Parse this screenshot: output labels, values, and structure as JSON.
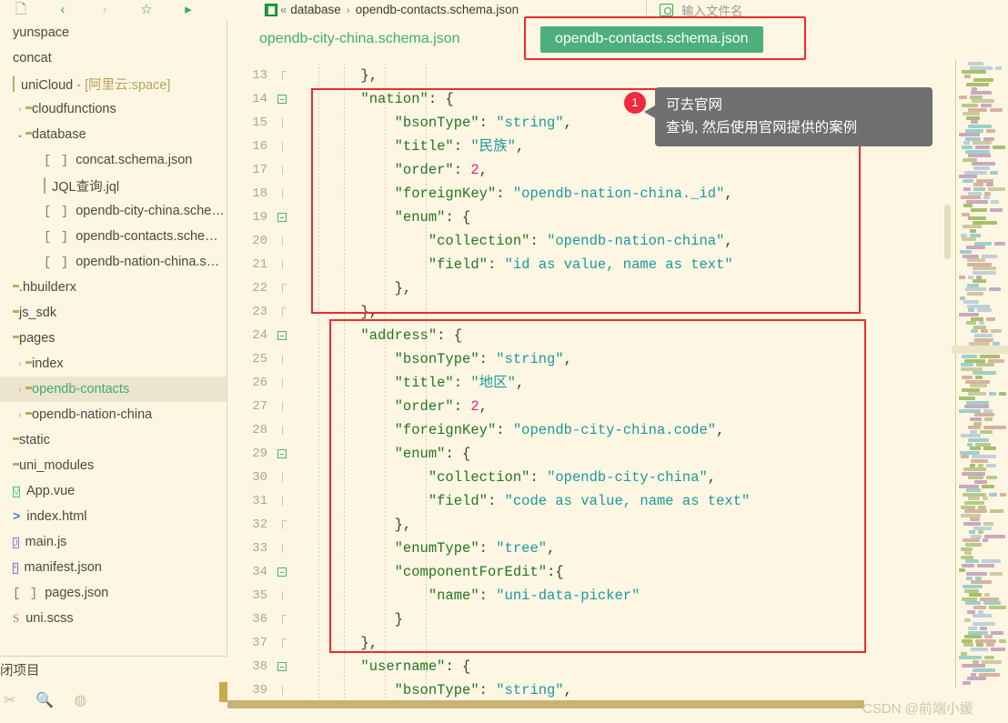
{
  "toolbar": {
    "icons": [
      {
        "name": "new-file-icon",
        "glyph": "🗋"
      },
      {
        "name": "back-icon",
        "glyph": "‹"
      },
      {
        "name": "forward-icon",
        "glyph": "›"
      },
      {
        "name": "favorite-star-icon",
        "glyph": "☆"
      },
      {
        "name": "run-icon",
        "glyph": "▷"
      }
    ],
    "breadcrumb": {
      "chevrons": "«",
      "folder": "database",
      "arrow": "›",
      "file": "opendb-contacts.schema.json"
    },
    "search": {
      "placeholder": "输入文件名",
      "value": "",
      "icon": "search-file-icon"
    }
  },
  "sidebar": {
    "items": [
      {
        "label": "yunspace",
        "icon": "none",
        "indent": 0,
        "chevron": "",
        "style": "plain"
      },
      {
        "label": "concat",
        "icon": "none",
        "indent": 0,
        "chevron": "",
        "style": "plain"
      },
      {
        "label": "uniCloud - [阿里云:space]",
        "icon": "cloud",
        "indent": 0,
        "chevron": "",
        "style": "unicloud"
      },
      {
        "label": "cloudfunctions",
        "icon": "folder-pale",
        "indent": 14,
        "chevron": "›",
        "style": "plain"
      },
      {
        "label": "database",
        "icon": "folder-open",
        "indent": 14,
        "chevron": "⌄",
        "style": "plain"
      },
      {
        "label": "concat.schema.json",
        "icon": "bracket",
        "indent": 34,
        "chevron": "",
        "style": "plain"
      },
      {
        "label": "JQL查询.jql",
        "icon": "jql",
        "indent": 34,
        "chevron": "",
        "style": "plain"
      },
      {
        "label": "opendb-city-china.sche…",
        "icon": "bracket",
        "indent": 34,
        "chevron": "",
        "style": "plain"
      },
      {
        "label": "opendb-contacts.sche…",
        "icon": "bracket",
        "indent": 34,
        "chevron": "",
        "style": "plain"
      },
      {
        "label": "opendb-nation-china.s…",
        "icon": "bracket",
        "indent": 34,
        "chevron": "",
        "style": "plain"
      },
      {
        "label": ".hbuilderx",
        "icon": "folder-closed",
        "indent": 0,
        "chevron": "",
        "style": "plain"
      },
      {
        "label": "js_sdk",
        "icon": "folder-closed",
        "indent": 0,
        "chevron": "",
        "style": "plain"
      },
      {
        "label": "pages",
        "icon": "folder-open",
        "indent": 0,
        "chevron": "",
        "style": "plain"
      },
      {
        "label": "index",
        "icon": "folder-closed",
        "indent": 14,
        "chevron": "›",
        "style": "plain"
      },
      {
        "label": "opendb-contacts",
        "icon": "folder-closed",
        "indent": 14,
        "chevron": "›",
        "style": "selected"
      },
      {
        "label": "opendb-nation-china",
        "icon": "folder-closed",
        "indent": 14,
        "chevron": "›",
        "style": "plain"
      },
      {
        "label": "static",
        "icon": "folder-closed",
        "indent": 0,
        "chevron": "",
        "style": "plain"
      },
      {
        "label": "uni_modules",
        "icon": "folder-closed",
        "indent": 0,
        "chevron": "",
        "style": "plain"
      },
      {
        "label": "App.vue",
        "icon": "vue",
        "indent": 0,
        "chevron": "",
        "style": "plain"
      },
      {
        "label": "index.html",
        "icon": "html",
        "indent": 0,
        "chevron": "",
        "style": "plain"
      },
      {
        "label": "main.js",
        "icon": "js",
        "indent": 0,
        "chevron": "",
        "style": "plain"
      },
      {
        "label": "manifest.json",
        "icon": "json",
        "indent": 0,
        "chevron": "",
        "style": "plain"
      },
      {
        "label": "pages.json",
        "icon": "bracket",
        "indent": 0,
        "chevron": "",
        "style": "plain"
      },
      {
        "label": "uni.scss",
        "icon": "scss",
        "indent": 0,
        "chevron": "",
        "style": "plain"
      }
    ],
    "close_project_label": "闭项目",
    "bottom_icons": [
      {
        "name": "cut-icon",
        "glyph": "✂"
      },
      {
        "name": "find-in-files-icon",
        "glyph": "🔍"
      },
      {
        "name": "cloud-globe-icon",
        "glyph": "◍"
      }
    ]
  },
  "tabs": [
    {
      "label": "opendb-city-china.schema.json",
      "active": false
    },
    {
      "label": "opendb-contacts.schema.json",
      "active": true
    }
  ],
  "callout": {
    "badge": "1",
    "line1": "可去官网",
    "line2": "查询, 然后使用官网提供的案例"
  },
  "editor": {
    "first_line_number": 13,
    "lines": [
      {
        "num": 13,
        "fold": "tick-cap",
        "tokens": [
          {
            "t": "        },",
            "c": "p"
          }
        ]
      },
      {
        "num": 14,
        "fold": "box",
        "tokens": [
          {
            "t": "        ",
            "c": "p"
          },
          {
            "t": "\"nation\"",
            "c": "k"
          },
          {
            "t": ": {",
            "c": "p"
          }
        ]
      },
      {
        "num": 15,
        "fold": "tick",
        "tokens": [
          {
            "t": "            ",
            "c": "p"
          },
          {
            "t": "\"bsonType\"",
            "c": "k"
          },
          {
            "t": ": ",
            "c": "p"
          },
          {
            "t": "\"string\"",
            "c": "s"
          },
          {
            "t": ",",
            "c": "p"
          }
        ]
      },
      {
        "num": 16,
        "fold": "tick",
        "tokens": [
          {
            "t": "            ",
            "c": "p"
          },
          {
            "t": "\"title\"",
            "c": "k"
          },
          {
            "t": ": ",
            "c": "p"
          },
          {
            "t": "\"民族\"",
            "c": "s"
          },
          {
            "t": ",",
            "c": "p"
          }
        ]
      },
      {
        "num": 17,
        "fold": "tick",
        "tokens": [
          {
            "t": "            ",
            "c": "p"
          },
          {
            "t": "\"order\"",
            "c": "k"
          },
          {
            "t": ": ",
            "c": "p"
          },
          {
            "t": "2",
            "c": "n"
          },
          {
            "t": ",",
            "c": "p"
          }
        ]
      },
      {
        "num": 18,
        "fold": "tick",
        "tokens": [
          {
            "t": "            ",
            "c": "p"
          },
          {
            "t": "\"foreignKey\"",
            "c": "k"
          },
          {
            "t": ": ",
            "c": "p"
          },
          {
            "t": "\"opendb-nation-china._id\"",
            "c": "s"
          },
          {
            "t": ",",
            "c": "p"
          }
        ]
      },
      {
        "num": 19,
        "fold": "box",
        "tokens": [
          {
            "t": "            ",
            "c": "p"
          },
          {
            "t": "\"enum\"",
            "c": "k"
          },
          {
            "t": ": {",
            "c": "p"
          }
        ]
      },
      {
        "num": 20,
        "fold": "tick",
        "tokens": [
          {
            "t": "                ",
            "c": "p"
          },
          {
            "t": "\"collection\"",
            "c": "k"
          },
          {
            "t": ": ",
            "c": "p"
          },
          {
            "t": "\"opendb-nation-china\"",
            "c": "s"
          },
          {
            "t": ",",
            "c": "p"
          }
        ]
      },
      {
        "num": 21,
        "fold": "tick",
        "tokens": [
          {
            "t": "                ",
            "c": "p"
          },
          {
            "t": "\"field\"",
            "c": "k"
          },
          {
            "t": ": ",
            "c": "p"
          },
          {
            "t": "\"id as value, name as text\"",
            "c": "s"
          }
        ]
      },
      {
        "num": 22,
        "fold": "tick-cap",
        "tokens": [
          {
            "t": "            },",
            "c": "p"
          }
        ]
      },
      {
        "num": 23,
        "fold": "tick-cap",
        "tokens": [
          {
            "t": "        },",
            "c": "p"
          }
        ]
      },
      {
        "num": 24,
        "fold": "box",
        "tokens": [
          {
            "t": "        ",
            "c": "p"
          },
          {
            "t": "\"address\"",
            "c": "k"
          },
          {
            "t": ": {",
            "c": "p"
          }
        ]
      },
      {
        "num": 25,
        "fold": "tick",
        "tokens": [
          {
            "t": "            ",
            "c": "p"
          },
          {
            "t": "\"bsonType\"",
            "c": "k"
          },
          {
            "t": ": ",
            "c": "p"
          },
          {
            "t": "\"string\"",
            "c": "s"
          },
          {
            "t": ",",
            "c": "p"
          }
        ]
      },
      {
        "num": 26,
        "fold": "tick",
        "tokens": [
          {
            "t": "            ",
            "c": "p"
          },
          {
            "t": "\"title\"",
            "c": "k"
          },
          {
            "t": ": ",
            "c": "p"
          },
          {
            "t": "\"地区\"",
            "c": "s"
          },
          {
            "t": ",",
            "c": "p"
          }
        ]
      },
      {
        "num": 27,
        "fold": "tick",
        "tokens": [
          {
            "t": "            ",
            "c": "p"
          },
          {
            "t": "\"order\"",
            "c": "k"
          },
          {
            "t": ": ",
            "c": "p"
          },
          {
            "t": "2",
            "c": "n"
          },
          {
            "t": ",",
            "c": "p"
          }
        ]
      },
      {
        "num": 28,
        "fold": "tick",
        "tokens": [
          {
            "t": "            ",
            "c": "p"
          },
          {
            "t": "\"foreignKey\"",
            "c": "k"
          },
          {
            "t": ": ",
            "c": "p"
          },
          {
            "t": "\"opendb-city-china.code\"",
            "c": "s"
          },
          {
            "t": ",",
            "c": "p"
          }
        ]
      },
      {
        "num": 29,
        "fold": "box",
        "tokens": [
          {
            "t": "            ",
            "c": "p"
          },
          {
            "t": "\"enum\"",
            "c": "k"
          },
          {
            "t": ": {",
            "c": "p"
          }
        ]
      },
      {
        "num": 30,
        "fold": "tick",
        "tokens": [
          {
            "t": "                ",
            "c": "p"
          },
          {
            "t": "\"collection\"",
            "c": "k"
          },
          {
            "t": ": ",
            "c": "p"
          },
          {
            "t": "\"opendb-city-china\"",
            "c": "s"
          },
          {
            "t": ",",
            "c": "p"
          }
        ]
      },
      {
        "num": 31,
        "fold": "tick",
        "tokens": [
          {
            "t": "                ",
            "c": "p"
          },
          {
            "t": "\"field\"",
            "c": "k"
          },
          {
            "t": ": ",
            "c": "p"
          },
          {
            "t": "\"code as value, name as text\"",
            "c": "s"
          }
        ]
      },
      {
        "num": 32,
        "fold": "tick-cap",
        "tokens": [
          {
            "t": "            },",
            "c": "p"
          }
        ]
      },
      {
        "num": 33,
        "fold": "tick",
        "tokens": [
          {
            "t": "            ",
            "c": "p"
          },
          {
            "t": "\"enumType\"",
            "c": "k"
          },
          {
            "t": ": ",
            "c": "p"
          },
          {
            "t": "\"tree\"",
            "c": "s"
          },
          {
            "t": ",",
            "c": "p"
          }
        ]
      },
      {
        "num": 34,
        "fold": "box",
        "tokens": [
          {
            "t": "            ",
            "c": "p"
          },
          {
            "t": "\"componentForEdit\"",
            "c": "k"
          },
          {
            "t": ":{",
            "c": "p"
          }
        ]
      },
      {
        "num": 35,
        "fold": "tick",
        "tokens": [
          {
            "t": "                ",
            "c": "p"
          },
          {
            "t": "\"name\"",
            "c": "k"
          },
          {
            "t": ": ",
            "c": "p"
          },
          {
            "t": "\"uni-data-picker\"",
            "c": "s"
          }
        ]
      },
      {
        "num": 36,
        "fold": "tick-cap",
        "tokens": [
          {
            "t": "            }",
            "c": "p"
          }
        ]
      },
      {
        "num": 37,
        "fold": "tick-cap",
        "tokens": [
          {
            "t": "        },",
            "c": "p"
          }
        ]
      },
      {
        "num": 38,
        "fold": "box",
        "tokens": [
          {
            "t": "        ",
            "c": "p"
          },
          {
            "t": "\"username\"",
            "c": "k"
          },
          {
            "t": ": {",
            "c": "p"
          }
        ]
      },
      {
        "num": 39,
        "fold": "tick",
        "tokens": [
          {
            "t": "            ",
            "c": "p"
          },
          {
            "t": "\"bsonType\"",
            "c": "k"
          },
          {
            "t": ": ",
            "c": "p"
          },
          {
            "t": "\"string\"",
            "c": "s"
          },
          {
            "t": ",",
            "c": "p"
          }
        ]
      }
    ]
  },
  "annotations": [
    {
      "name": "nation-block-highlight"
    },
    {
      "name": "address-block-highlight"
    },
    {
      "name": "active-tab-highlight"
    }
  ],
  "watermark": "CSDN @前端小媛",
  "colors": {
    "background": "#fdf6e3",
    "accent_green": "#4caf7d",
    "annotation_red": "#ee2b2b",
    "key_green": "#227722",
    "string_teal": "#1a9a9a",
    "number_pink": "#e0218a",
    "gutter_text": "#b0a68a",
    "selection": "#ece4cd"
  }
}
